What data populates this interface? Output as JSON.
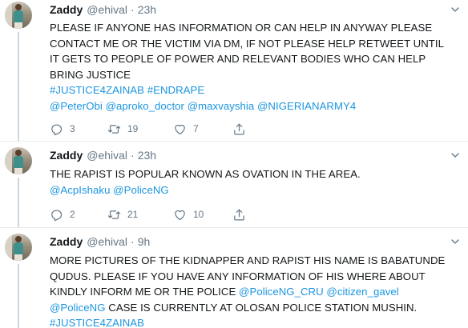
{
  "tweets": [
    {
      "name": "Zaddy",
      "handle": "@ehival",
      "separator": "·",
      "time": "23h",
      "lines": [
        [
          {
            "t": "PLEASE IF ANYONE HAS INFORMATION OR CAN HELP IN ANYWAY PLEASE"
          }
        ],
        [
          {
            "t": "CONTACT ME OR THE VICTIM VIA DM, IF NOT PLEASE HELP RETWEET UNTIL"
          }
        ],
        [
          {
            "t": "IT GETS TO PEOPLE OF POWER AND RELEVANT BODIES WHO CAN HELP"
          }
        ],
        [
          {
            "t": "BRING JUSTICE"
          }
        ],
        [
          {
            "t": "#JUSTICE4ZAINAB #ENDRAPE",
            "link": true
          }
        ],
        [
          {
            "t": "@PeterObi @aproko_doctor @maxvayshia @NIGERIANARMY4",
            "link": true
          }
        ]
      ],
      "replies": "3",
      "retweets": "19",
      "likes": "7"
    },
    {
      "name": "Zaddy",
      "handle": "@ehival",
      "separator": "·",
      "time": "23h",
      "lines": [
        [
          {
            "t": "THE RAPIST IS POPULAR KNOWN AS OVATION IN THE AREA."
          }
        ],
        [
          {
            "t": "@AcpIshaku @PoliceNG",
            "link": true
          }
        ]
      ],
      "replies": "2",
      "retweets": "21",
      "likes": "10"
    },
    {
      "name": "Zaddy",
      "handle": "@ehival",
      "separator": "·",
      "time": "9h",
      "lines": [
        [
          {
            "t": "MORE PICTURES OF THE KIDNAPPER AND RAPIST HIS NAME IS BABATUNDE"
          }
        ],
        [
          {
            "t": "QUDUS. PLEASE IF YOU HAVE ANY INFORMATION OF HIS WHERE ABOUT"
          }
        ],
        [
          {
            "t": "KINDLY INFORM ME OR THE POLICE "
          },
          {
            "t": "@PoliceNG_CRU @citizen_gavel",
            "link": true
          }
        ],
        [
          {
            "t": "@PoliceNG",
            "link": true
          },
          {
            "t": " CASE IS CURRENTLY AT OLOSAN POLICE STATION MUSHIN."
          }
        ],
        [
          {
            "t": "#JUSTICE4ZAINAB",
            "link": true
          }
        ]
      ]
    }
  ]
}
